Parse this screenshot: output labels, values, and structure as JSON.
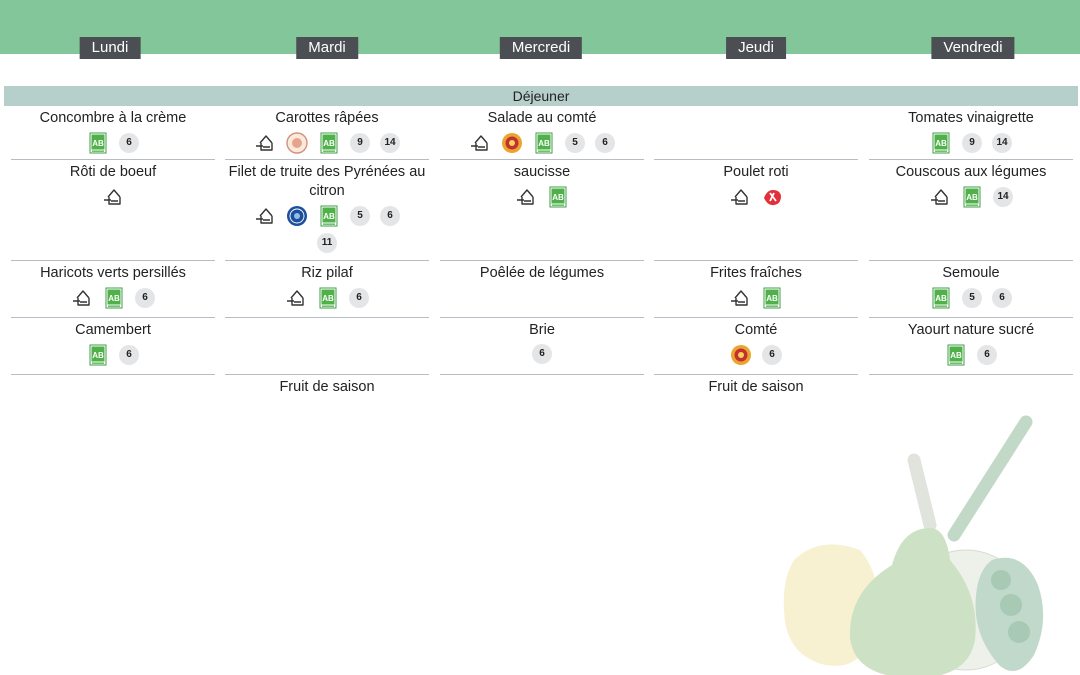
{
  "days": [
    "Lundi",
    "Mardi",
    "Mercredi",
    "Jeudi",
    "Vendredi"
  ],
  "meal": "Déjeuner",
  "colors": {
    "header": "#83c699",
    "tab": "#4b4f54",
    "band": "#b7cfcb",
    "divider": "#b8bcc4"
  },
  "columns": [
    [
      {
        "dish": "Concombre à la crème",
        "badges": [
          {
            "icon": "bio-label-icon"
          },
          {
            "num": "6"
          }
        ]
      },
      {
        "dish": "Rôti de boeuf",
        "badges": [
          {
            "icon": "local-farm-icon"
          }
        ]
      },
      {
        "dish": "Haricots verts persillés",
        "badges": [
          {
            "icon": "local-farm-icon"
          },
          {
            "icon": "bio-label-icon"
          },
          {
            "num": "6"
          }
        ]
      },
      {
        "dish": "Camembert",
        "badges": [
          {
            "icon": "bio-label-icon"
          },
          {
            "num": "6"
          }
        ]
      },
      {
        "dish": "",
        "badges": []
      }
    ],
    [
      {
        "dish": "Carottes râpées",
        "badges": [
          {
            "icon": "local-farm-icon"
          },
          {
            "icon": "producer-seal-icon"
          },
          {
            "icon": "bio-label-icon"
          },
          {
            "num": "9"
          },
          {
            "num": "14"
          }
        ]
      },
      {
        "dish": "Filet de truite des Pyrénées au citron",
        "badges": [
          {
            "icon": "local-farm-icon"
          },
          {
            "icon": "blue-seal-icon"
          },
          {
            "icon": "bio-label-icon"
          },
          {
            "num": "5"
          },
          {
            "num": "6"
          },
          {
            "num": "11"
          }
        ]
      },
      {
        "dish": "Riz pilaf",
        "badges": [
          {
            "icon": "local-farm-icon"
          },
          {
            "icon": "bio-label-icon"
          },
          {
            "num": "6"
          }
        ]
      },
      {
        "dish": "",
        "badges": []
      },
      {
        "dish": "Fruit de saison",
        "badges": []
      }
    ],
    [
      {
        "dish": "Salade au comté",
        "badges": [
          {
            "icon": "local-farm-icon"
          },
          {
            "icon": "aop-seal-icon"
          },
          {
            "icon": "bio-label-icon"
          },
          {
            "num": "5"
          },
          {
            "num": "6"
          }
        ]
      },
      {
        "dish": "saucisse",
        "badges": [
          {
            "icon": "local-farm-icon"
          },
          {
            "icon": "bio-label-icon"
          }
        ]
      },
      {
        "dish": "Poêlée de légumes",
        "badges": []
      },
      {
        "dish": "Brie",
        "badges": [
          {
            "num": "6"
          }
        ]
      },
      {
        "dish": "",
        "badges": []
      }
    ],
    [
      {
        "dish": "",
        "badges": []
      },
      {
        "dish": "Poulet roti",
        "badges": [
          {
            "icon": "local-farm-icon"
          },
          {
            "icon": "label-rouge-icon"
          }
        ]
      },
      {
        "dish": "Frites fraîches",
        "badges": [
          {
            "icon": "local-farm-icon"
          },
          {
            "icon": "bio-label-icon"
          }
        ]
      },
      {
        "dish": "Comté",
        "badges": [
          {
            "icon": "aop-seal-icon"
          },
          {
            "num": "6"
          }
        ]
      },
      {
        "dish": "Fruit de saison",
        "badges": []
      }
    ],
    [
      {
        "dish": "Tomates vinaigrette",
        "badges": [
          {
            "icon": "bio-label-icon"
          },
          {
            "num": "9"
          },
          {
            "num": "14"
          }
        ]
      },
      {
        "dish": "Couscous aux légumes",
        "badges": [
          {
            "icon": "local-farm-icon"
          },
          {
            "icon": "bio-label-icon"
          },
          {
            "num": "14"
          }
        ]
      },
      {
        "dish": "Semoule",
        "badges": [
          {
            "icon": "bio-label-icon"
          },
          {
            "num": "5"
          },
          {
            "num": "6"
          }
        ]
      },
      {
        "dish": "Yaourt nature sucré",
        "badges": [
          {
            "icon": "bio-label-icon"
          },
          {
            "num": "6"
          }
        ]
      },
      {
        "dish": "",
        "badges": []
      }
    ]
  ]
}
